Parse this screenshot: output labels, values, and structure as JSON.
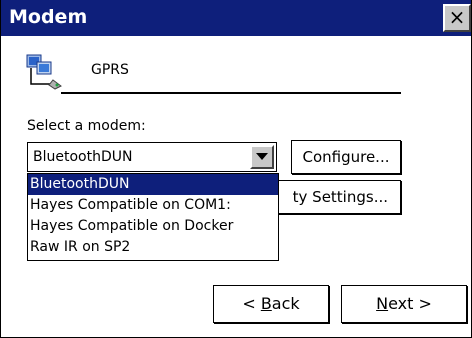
{
  "window": {
    "title": "Modem",
    "close_label": "×"
  },
  "connection": {
    "name": "GPRS",
    "icon": "modem-connection-icon"
  },
  "modem_select": {
    "label": "Select a modem:",
    "value": "BluetoothDUN",
    "options": [
      "BluetoothDUN",
      "Hayes Compatible on COM1:",
      "Hayes Compatible on Docker",
      "Raw IR on SP2"
    ],
    "selected_index": 0
  },
  "buttons": {
    "configure": "Configure...",
    "security_settings_visible": "ty Settings...",
    "back_mnemonic": "B",
    "back_rest": "ack",
    "back_prefix": "< ",
    "next_mnemonic": "N",
    "next_rest": "ext",
    "next_suffix": " >"
  },
  "colors": {
    "titlebar": "#0e1f7b",
    "selection": "#0e1f7b"
  }
}
